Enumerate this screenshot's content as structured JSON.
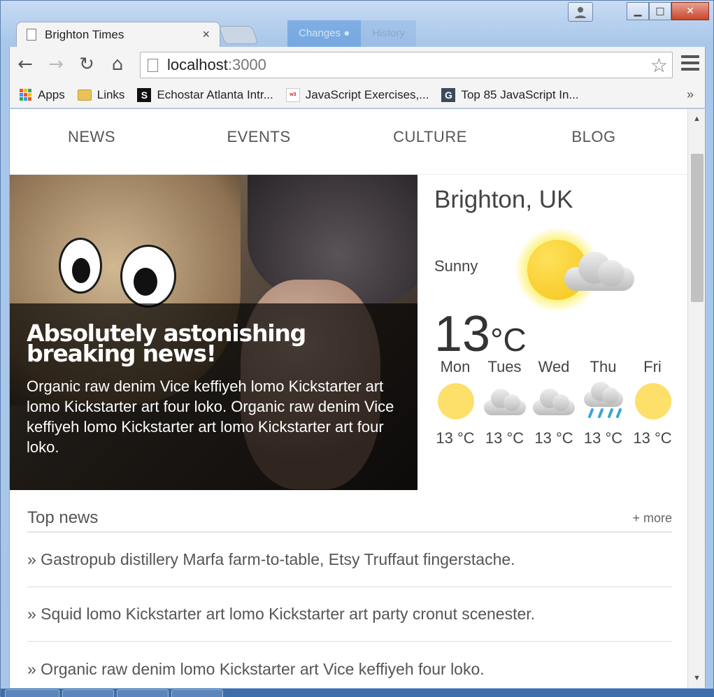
{
  "browser": {
    "tab_title": "Brighton Times",
    "tab_close": "×",
    "background_tabs": [
      "Changes ●",
      "History"
    ],
    "url_host": "localhost",
    "url_port": ":3000",
    "star_glyph": "☆",
    "nav": {
      "back": "←",
      "forward": "→",
      "reload": "↻",
      "home": "⌂"
    },
    "bookmarks": [
      {
        "label": "Apps",
        "icon": "apps-grid-icon"
      },
      {
        "label": "Links",
        "icon": "folder-icon"
      },
      {
        "label": "Echostar Atlanta Intr...",
        "icon": "s-favicon",
        "glyph": "S"
      },
      {
        "label": "JavaScript Exercises,...",
        "icon": "w3resource-favicon",
        "glyph": "w3"
      },
      {
        "label": "Top 85 JavaScript In...",
        "icon": "g-favicon",
        "glyph": "G"
      }
    ],
    "bookmarks_more": "»"
  },
  "site_nav": [
    "NEWS",
    "EVENTS",
    "CULTURE",
    "BLOG"
  ],
  "hero": {
    "headline": "Absolutely astonishing breaking news!",
    "body": "Organic raw denim Vice keffiyeh lomo Kickstarter art lomo Kickstarter art four loko. Organic raw denim Vice keffiyeh lomo Kickstarter art lomo Kickstarter art four loko."
  },
  "weather": {
    "city": "Brighton, UK",
    "condition": "Sunny",
    "temp": "13",
    "unit": "°C",
    "forecast": [
      {
        "day": "Mon",
        "temp": "13 °C",
        "icon": "sun-icon"
      },
      {
        "day": "Tues",
        "temp": "13 °C",
        "icon": "cloud-icon"
      },
      {
        "day": "Wed",
        "temp": "13 °C",
        "icon": "cloud-icon"
      },
      {
        "day": "Thu",
        "temp": "13 °C",
        "icon": "rain-icon"
      },
      {
        "day": "Fri",
        "temp": "13 °C",
        "icon": "sun-icon"
      }
    ]
  },
  "top_news": {
    "title": "Top news",
    "more": "+ more",
    "items": [
      "» Gastropub distillery Marfa farm-to-table, Etsy Truffaut fingerstache.",
      "» Squid lomo Kickstarter art lomo Kickstarter art party cronut scenester.",
      "» Organic raw denim lomo Kickstarter art Vice keffiyeh four loko."
    ]
  }
}
